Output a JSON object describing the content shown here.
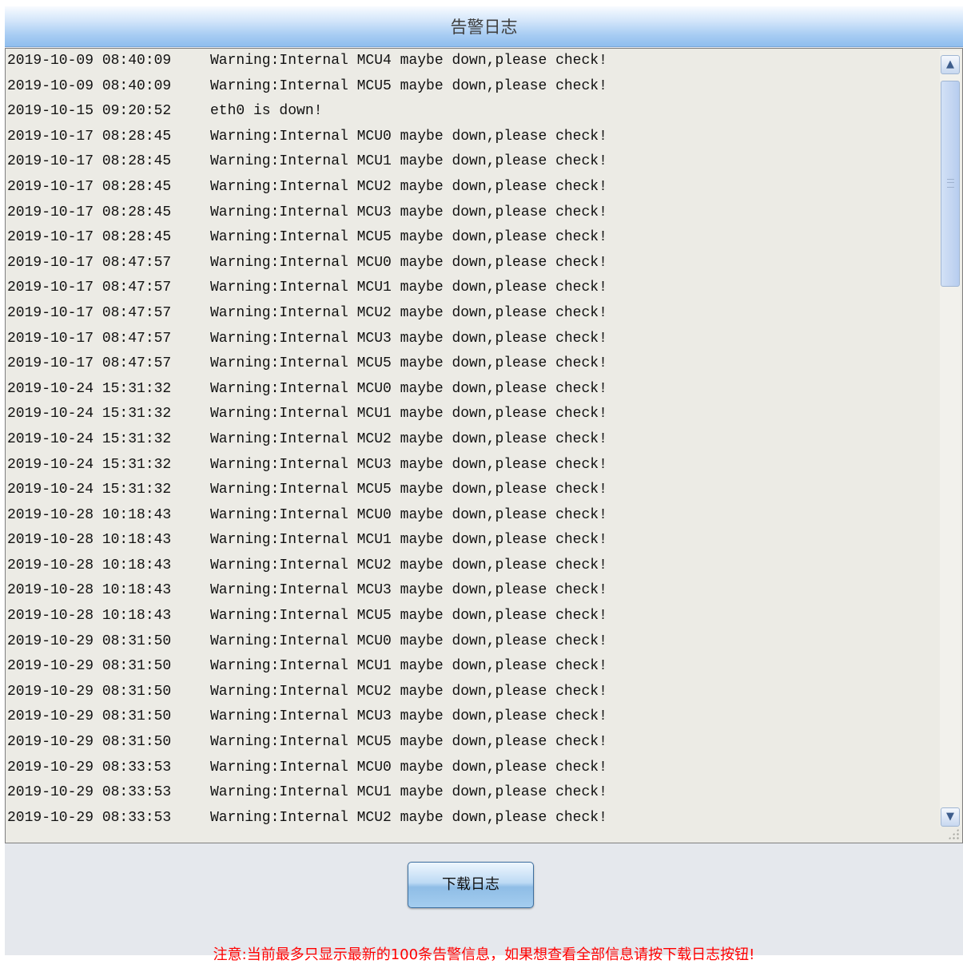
{
  "title": "告警日志",
  "log": [
    {
      "time": "2019-10-09 08:40:09",
      "message": "Warning:Internal MCU4 maybe down,please check!"
    },
    {
      "time": "2019-10-09 08:40:09",
      "message": "Warning:Internal MCU5 maybe down,please check!"
    },
    {
      "time": "2019-10-15 09:20:52",
      "message": "eth0 is down!"
    },
    {
      "time": "2019-10-17 08:28:45",
      "message": "Warning:Internal MCU0 maybe down,please check!"
    },
    {
      "time": "2019-10-17 08:28:45",
      "message": "Warning:Internal MCU1 maybe down,please check!"
    },
    {
      "time": "2019-10-17 08:28:45",
      "message": "Warning:Internal MCU2 maybe down,please check!"
    },
    {
      "time": "2019-10-17 08:28:45",
      "message": "Warning:Internal MCU3 maybe down,please check!"
    },
    {
      "time": "2019-10-17 08:28:45",
      "message": "Warning:Internal MCU5 maybe down,please check!"
    },
    {
      "time": "2019-10-17 08:47:57",
      "message": "Warning:Internal MCU0 maybe down,please check!"
    },
    {
      "time": "2019-10-17 08:47:57",
      "message": "Warning:Internal MCU1 maybe down,please check!"
    },
    {
      "time": "2019-10-17 08:47:57",
      "message": "Warning:Internal MCU2 maybe down,please check!"
    },
    {
      "time": "2019-10-17 08:47:57",
      "message": "Warning:Internal MCU3 maybe down,please check!"
    },
    {
      "time": "2019-10-17 08:47:57",
      "message": "Warning:Internal MCU5 maybe down,please check!"
    },
    {
      "time": "2019-10-24 15:31:32",
      "message": "Warning:Internal MCU0 maybe down,please check!"
    },
    {
      "time": "2019-10-24 15:31:32",
      "message": "Warning:Internal MCU1 maybe down,please check!"
    },
    {
      "time": "2019-10-24 15:31:32",
      "message": "Warning:Internal MCU2 maybe down,please check!"
    },
    {
      "time": "2019-10-24 15:31:32",
      "message": "Warning:Internal MCU3 maybe down,please check!"
    },
    {
      "time": "2019-10-24 15:31:32",
      "message": "Warning:Internal MCU5 maybe down,please check!"
    },
    {
      "time": "2019-10-28 10:18:43",
      "message": "Warning:Internal MCU0 maybe down,please check!"
    },
    {
      "time": "2019-10-28 10:18:43",
      "message": "Warning:Internal MCU1 maybe down,please check!"
    },
    {
      "time": "2019-10-28 10:18:43",
      "message": "Warning:Internal MCU2 maybe down,please check!"
    },
    {
      "time": "2019-10-28 10:18:43",
      "message": "Warning:Internal MCU3 maybe down,please check!"
    },
    {
      "time": "2019-10-28 10:18:43",
      "message": "Warning:Internal MCU5 maybe down,please check!"
    },
    {
      "time": "2019-10-29 08:31:50",
      "message": "Warning:Internal MCU0 maybe down,please check!"
    },
    {
      "time": "2019-10-29 08:31:50",
      "message": "Warning:Internal MCU1 maybe down,please check!"
    },
    {
      "time": "2019-10-29 08:31:50",
      "message": "Warning:Internal MCU2 maybe down,please check!"
    },
    {
      "time": "2019-10-29 08:31:50",
      "message": "Warning:Internal MCU3 maybe down,please check!"
    },
    {
      "time": "2019-10-29 08:31:50",
      "message": "Warning:Internal MCU5 maybe down,please check!"
    },
    {
      "time": "2019-10-29 08:33:53",
      "message": "Warning:Internal MCU0 maybe down,please check!"
    },
    {
      "time": "2019-10-29 08:33:53",
      "message": "Warning:Internal MCU1 maybe down,please check!"
    },
    {
      "time": "2019-10-29 08:33:53",
      "message": "Warning:Internal MCU2 maybe down,please check!"
    }
  ],
  "scrollbar": {
    "up_icon": "▲",
    "down_icon": "▼"
  },
  "download_button": "下载日志",
  "notice": "注意:当前最多只显示最新的100条告警信息，如果想查看全部信息请按下载日志按钮!",
  "colors": {
    "title_bar": "#a9cdf3",
    "log_bg": "#ecebe5",
    "page_bg": "#e5e8ed",
    "notice": "#ff0000"
  }
}
